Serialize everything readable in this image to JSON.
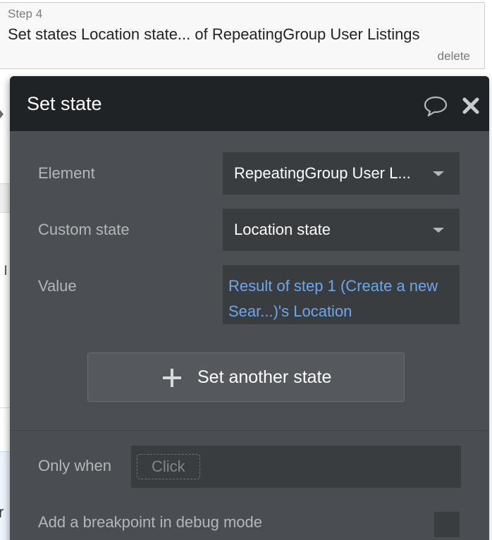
{
  "step": {
    "label": "Step 4",
    "title": "Set states Location state... of RepeatingGroup User Listings",
    "delete_label": "delete"
  },
  "popup": {
    "title": "Set state",
    "icons": {
      "comment": "speech-bubble-icon",
      "close": "close-icon"
    },
    "fields": {
      "element": {
        "label": "Element",
        "value": "RepeatingGroup User L..."
      },
      "custom_state": {
        "label": "Custom state",
        "value": "Location state"
      },
      "value": {
        "label": "Value",
        "value": "Result of step 1 (Create a new Sear...)'s Location"
      }
    },
    "set_another_label": "Set another state",
    "only_when": {
      "label": "Only when",
      "placeholder": "Click"
    },
    "breakpoint": {
      "label": "Add a breakpoint in debug mode",
      "checked": false
    }
  },
  "background": {
    "glyph_1": "l",
    "glyph_2": "r"
  },
  "colors": {
    "popup_bg": "#4b4f53",
    "header_bg": "#1f2326",
    "field_bg": "#3a3d40",
    "label_text": "#b3b7ba",
    "link_blue": "#6aa7ef"
  }
}
